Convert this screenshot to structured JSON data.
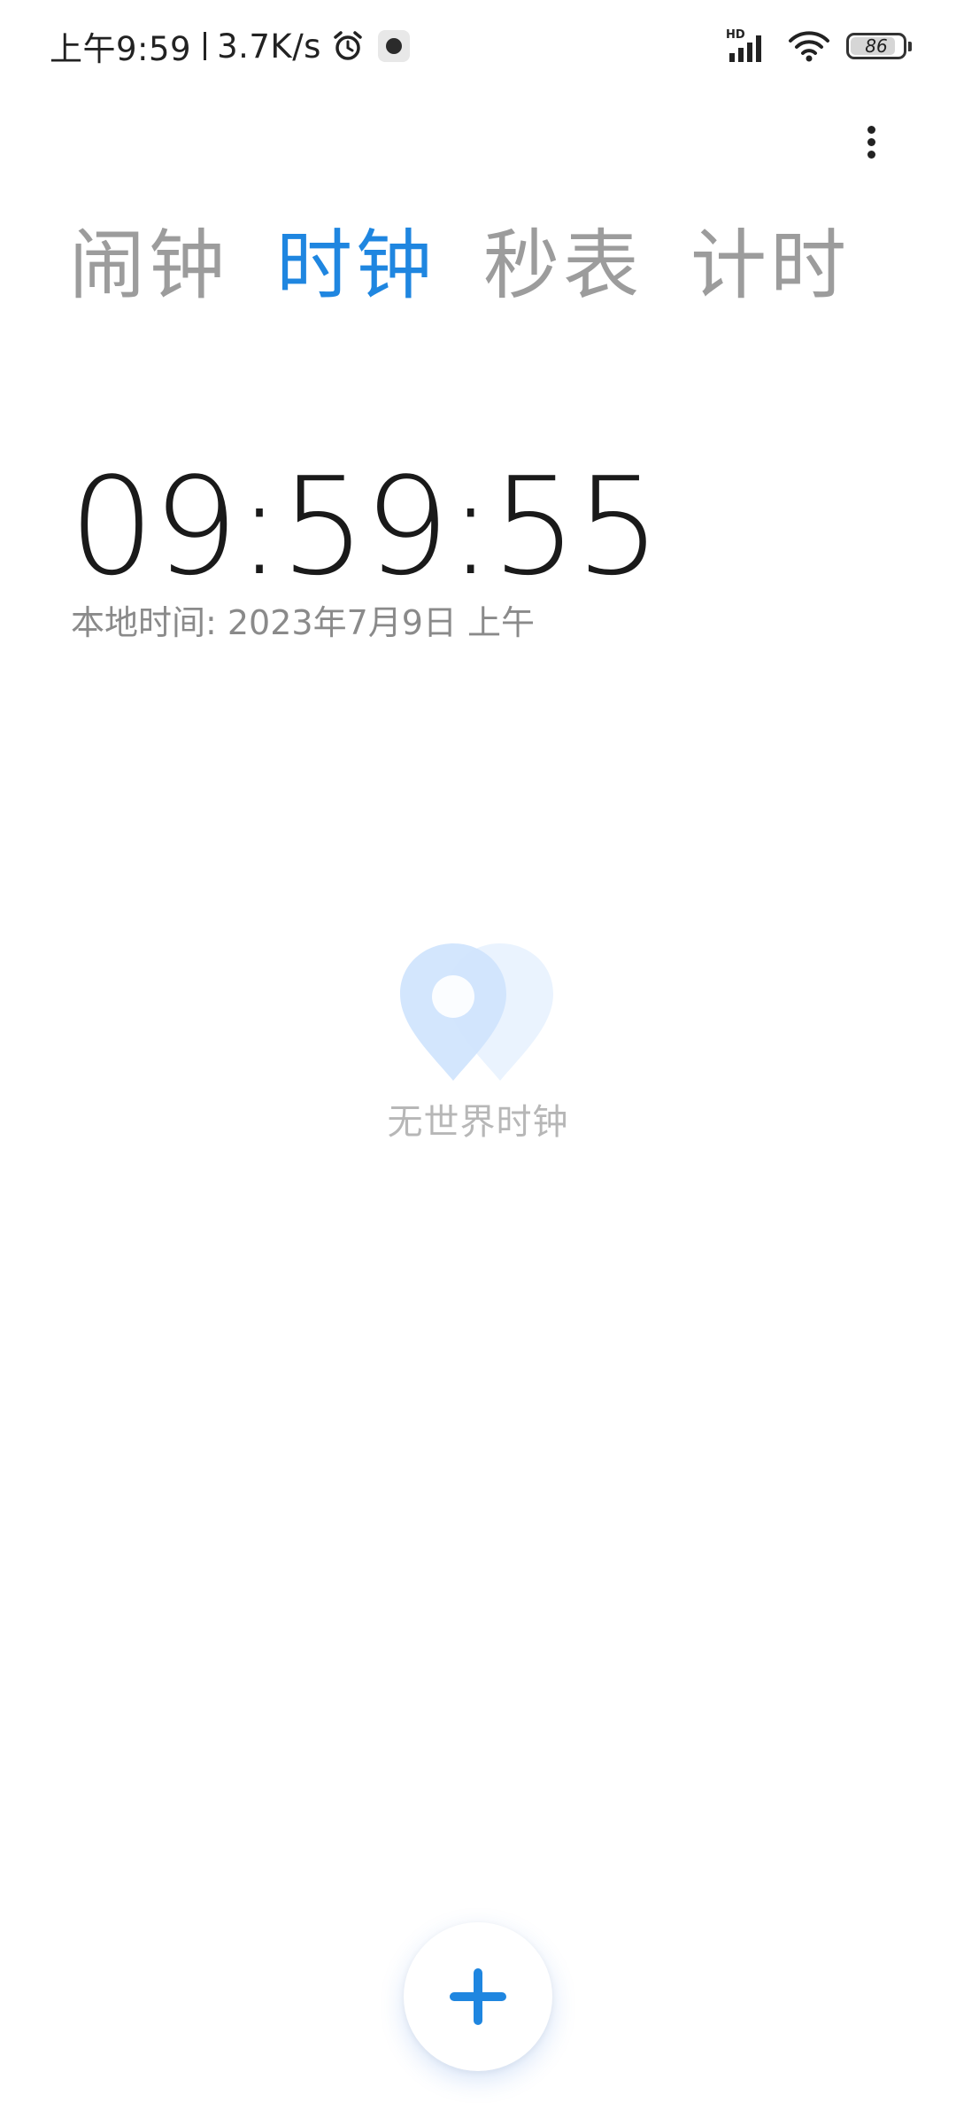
{
  "status_bar": {
    "time": "上午9:59",
    "net_speed": "3.7K/s",
    "signal_label": "HD",
    "battery_level": "86",
    "battery_fraction": 0.86,
    "alarm_icon": "alarm-clock-icon",
    "app_icon": "app-notification-icon",
    "signal_icon": "cellular-signal-icon",
    "wifi_icon": "wifi-icon",
    "battery_icon": "battery-icon"
  },
  "toolbar": {
    "more_icon": "more-vertical-icon"
  },
  "tabs": [
    {
      "label": "闹钟",
      "active": false
    },
    {
      "label": "时钟",
      "active": true
    },
    {
      "label": "秒表",
      "active": false
    },
    {
      "label": "计时",
      "active": false
    }
  ],
  "clock": {
    "time": "09:59:55",
    "local_time_label": "本地时间: 2023年7月9日 上午"
  },
  "empty_state": {
    "icon": "location-pin-icon",
    "label": "无世界时钟"
  },
  "fab": {
    "icon": "plus-icon"
  },
  "colors": {
    "accent": "#1f86e0",
    "tab_inactive": "#9c9c9c",
    "text_primary": "#1a1a1a",
    "text_secondary": "#8a8a8a",
    "empty_text": "#b7b7b7",
    "pin_primary": "#cfe4fd",
    "pin_secondary": "#eaf3fe"
  }
}
